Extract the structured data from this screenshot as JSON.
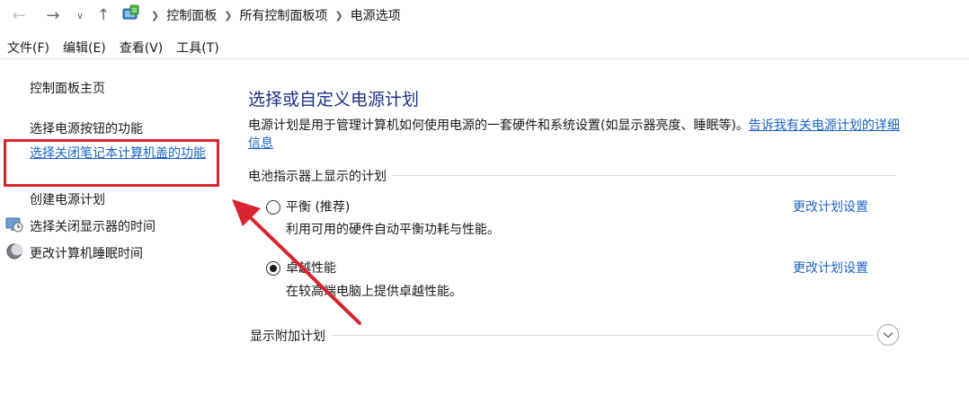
{
  "address_bar": {
    "crumbs": [
      "控制面板",
      "所有控制面板项",
      "电源选项"
    ]
  },
  "menu": [
    "文件(F)",
    "编辑(E)",
    "查看(V)",
    "工具(T)"
  ],
  "sidebar": {
    "home": "控制面板主页",
    "items": [
      {
        "label": "选择电源按钮的功能",
        "icon": ""
      },
      {
        "label": "选择关闭笔记本计算机盖的功能",
        "icon": "",
        "highlighted": true
      },
      {
        "label": "创建电源计划",
        "icon": ""
      },
      {
        "label": "选择关闭显示器的时间",
        "icon": "monitor-clock-icon"
      },
      {
        "label": "更改计算机睡眠时间",
        "icon": "sleep-moon-icon"
      }
    ]
  },
  "main": {
    "title": "选择或自定义电源计划",
    "intro_text": "电源计划是用于管理计算机如何使用电源的一套硬件和系统设置(如显示器亮度、睡眠等)。",
    "intro_link": "告诉我有关电源计划的详细信息",
    "section_label": "电池指示器上显示的计划",
    "plans": [
      {
        "name": "平衡 (推荐)",
        "description": "利用可用的硬件自动平衡功耗与性能。",
        "link": "更改计划设置",
        "selected": false
      },
      {
        "name": "卓越性能",
        "description": "在较高端电脑上提供卓越性能。",
        "link": "更改计划设置",
        "selected": true
      }
    ],
    "more_plans_label": "显示附加计划"
  },
  "colors": {
    "link": "#1b63c4",
    "title": "#1e3287",
    "highlight": "#d9232e"
  }
}
